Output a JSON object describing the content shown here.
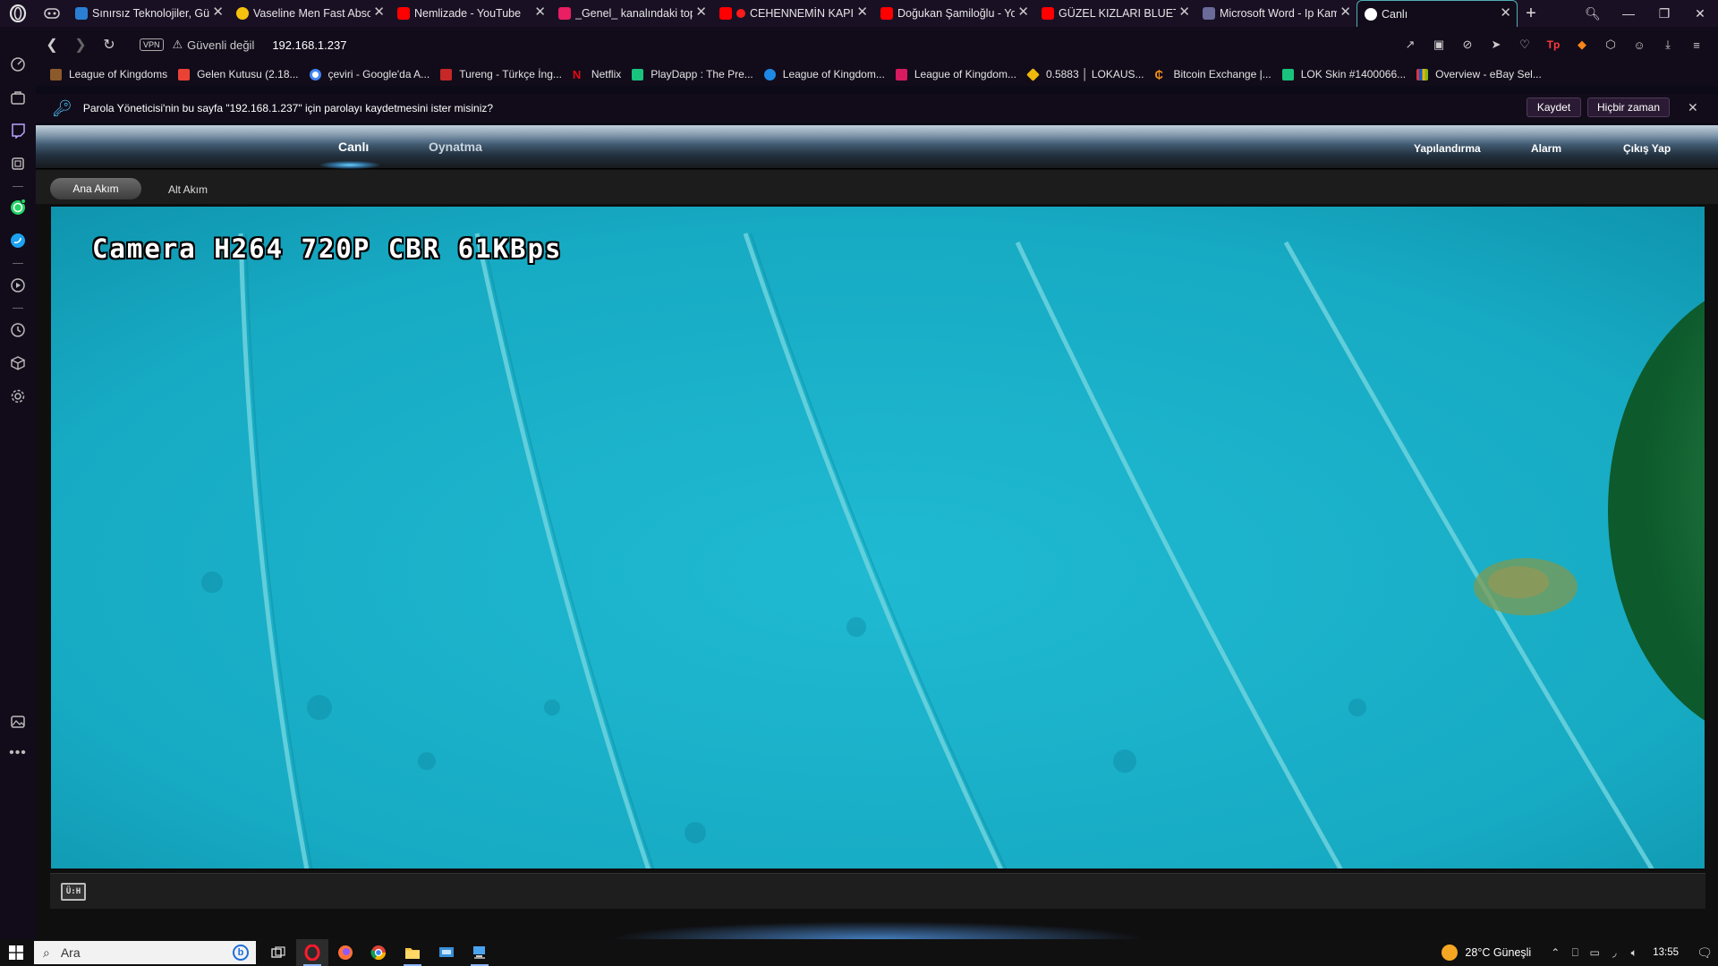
{
  "browser": {
    "tabs": [
      {
        "label": "Sınırsız Teknolojiler, Gü",
        "favicon_color": "#2a7fd4",
        "icon": "atlassian-icon"
      },
      {
        "label": "Vaseline Men Fast Abso",
        "favicon_color": "#f4c20d",
        "icon": "walmart-icon"
      },
      {
        "label": "Nemlizade - YouTube",
        "favicon_color": "#ff0000",
        "icon": "youtube-icon"
      },
      {
        "label": "_Genel_ kanalındaki top",
        "favicon_color": "#e91e63",
        "icon": "play-icon"
      },
      {
        "label": "CEHENNEMİN KAPI",
        "favicon_color": "#ff0000",
        "icon": "youtube-icon"
      },
      {
        "label": "Doğukan Şamiloğlu - Yo",
        "favicon_color": "#ff0000",
        "icon": "youtube-icon"
      },
      {
        "label": "GÜZEL KIZLARI BLUETO",
        "favicon_color": "#ff0000",
        "icon": "youtube-icon"
      },
      {
        "label": "Microsoft Word - Ip Kam",
        "favicon_color": "#6b6b9a",
        "icon": "document-icon"
      },
      {
        "label": "Canlı",
        "favicon_color": "#ffffff",
        "icon": "globe-icon",
        "active": true
      }
    ],
    "address": {
      "vpn": "VPN",
      "security": "Güvenli değil",
      "url": "192.168.1.237"
    },
    "bookmarks": [
      {
        "label": "League of Kingdoms",
        "color": "#8b5a2b"
      },
      {
        "label": "Gelen Kutusu (2.18...",
        "color": "#ea4335"
      },
      {
        "label": "çeviri - Google'da A...",
        "color": "#4285f4"
      },
      {
        "label": "Tureng - Türkçe İng...",
        "color": "#c62828"
      },
      {
        "label": "Netflix",
        "color": "#e50914"
      },
      {
        "label": "PlayDapp : The Pre...",
        "color": "#19c37d"
      },
      {
        "label": "League of Kingdom...",
        "color": "#1e88e5"
      },
      {
        "label": "League of Kingdom...",
        "color": "#d81b60"
      },
      {
        "label": "0.5883 │ LOKAUS...",
        "color": "#f0b90b"
      },
      {
        "label": "Bitcoin Exchange |...",
        "color": "#f7931a"
      },
      {
        "label": "LOK Skin #1400066...",
        "color": "#19c37d"
      },
      {
        "label": "Overview - eBay Sel...",
        "color": "#e53238"
      }
    ],
    "password_bar": {
      "message": "Parola Yöneticisi'nin bu sayfa \"192.168.1.237\" için parolayı kaydetmesini ister misiniz?",
      "save_label": "Kaydet",
      "never_label": "Hiçbir zaman"
    }
  },
  "camera_app": {
    "nav": {
      "live": "Canlı",
      "playback": "Oynatma",
      "config": "Yapılandırma",
      "alarm": "Alarm",
      "logout": "Çıkış Yap"
    },
    "streams": {
      "main": "Ana Akım",
      "sub": "Alt Akım"
    },
    "osd": "Camera H264 720P CBR 61KBps",
    "fullscreen_label": "Ü:H"
  },
  "taskbar": {
    "search_placeholder": "Ara",
    "weather": "28°C  Güneşli",
    "time": "13:55"
  }
}
